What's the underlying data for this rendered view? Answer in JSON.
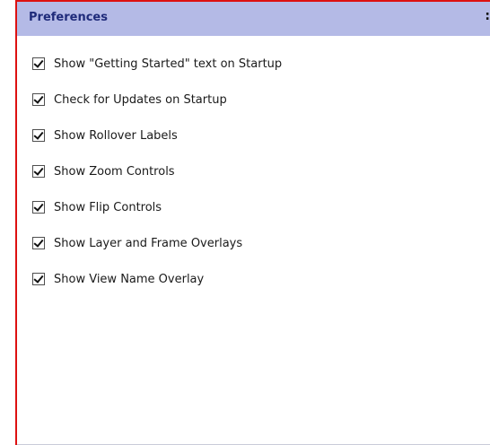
{
  "panel": {
    "title": "Preferences",
    "close_glyph": ":"
  },
  "options": [
    {
      "label": "Show \"Getting Started\" text on Startup",
      "checked": true
    },
    {
      "label": "Check for Updates on Startup",
      "checked": true
    },
    {
      "label": "Show Rollover Labels",
      "checked": true
    },
    {
      "label": "Show Zoom Controls",
      "checked": true
    },
    {
      "label": "Show Flip Controls",
      "checked": true
    },
    {
      "label": "Show Layer and Frame Overlays",
      "checked": true
    },
    {
      "label": "Show View Name Overlay",
      "checked": true
    }
  ],
  "colors": {
    "titlebar": "#b4bae6",
    "title_text": "#1f2b7a",
    "frame_border": "#dd1111"
  }
}
